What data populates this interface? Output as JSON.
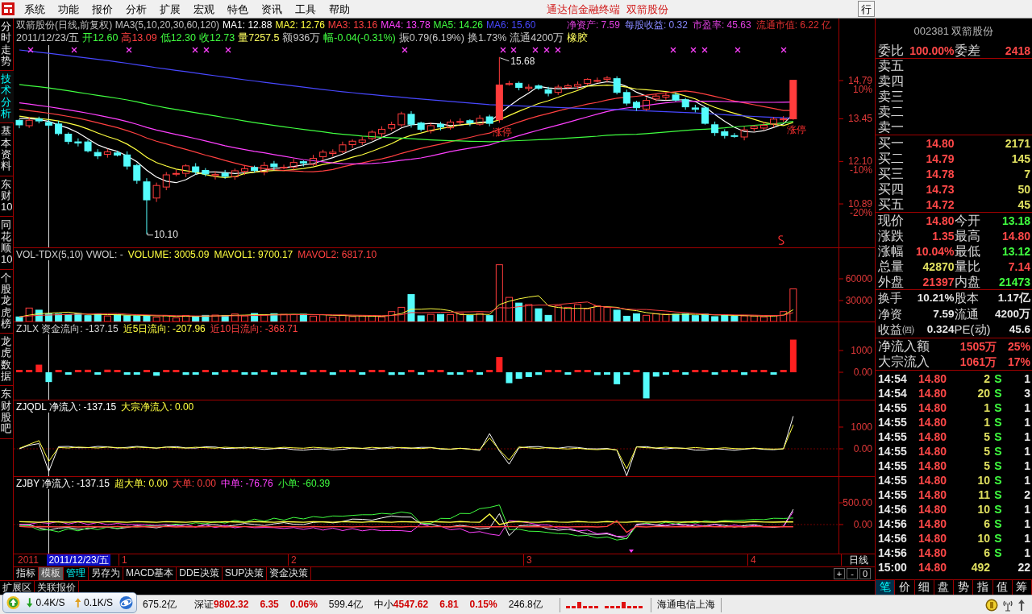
{
  "menu_bar": {
    "items": [
      "系统",
      "功能",
      "报价",
      "分析",
      "扩展",
      "宏观",
      "特色",
      "资讯",
      "工具",
      "帮助"
    ],
    "title": "通达信金融终端",
    "stock": "双箭股份",
    "button": "行"
  },
  "side_tabs": [
    {
      "label": "分时走势",
      "selected": false
    },
    {
      "label": "技术分析",
      "selected": true
    },
    {
      "label": "基本资料",
      "selected": false
    },
    {
      "label": "东财10",
      "selected": false
    },
    {
      "label": "同花顺10",
      "selected": false
    },
    {
      "label": "个股龙虎榜",
      "selected": false
    },
    {
      "label": "龙虎数据",
      "selected": false
    },
    {
      "label": "东财股吧",
      "selected": false
    }
  ],
  "price_chart": {
    "legend": [
      {
        "text": "双箭股份(日线,前复权) MA3(5,10,20,30,60,120)",
        "color": "#c0c0c0"
      },
      {
        "text": "MA1: 12.88",
        "color": "#ffffff"
      },
      {
        "text": "MA2: 12.76",
        "color": "#ffff40"
      },
      {
        "text": "MA3: 13.16",
        "color": "#ff4040"
      },
      {
        "text": "MA4: 13.78",
        "color": "#ff40ff"
      },
      {
        "text": "MA5: 14.26",
        "color": "#40ff40"
      },
      {
        "text": "MA6: 15.60",
        "color": "#4848ff"
      }
    ],
    "fundamentals": [
      {
        "text": "净资产: 7.59",
        "color": "#e040e0"
      },
      {
        "text": "每股收益: 0.32",
        "color": "#8888ff"
      },
      {
        "text": "市盈率: 45.63",
        "color": "#e040e0"
      },
      {
        "text": "流通市值: 6.22 亿",
        "color": "#e03030"
      }
    ],
    "day_info": [
      {
        "text": "2011/12/23/五",
        "color": "#c8c8c8"
      },
      {
        "text": "开12.60",
        "color": "#40ff40"
      },
      {
        "text": "高13.09",
        "color": "#ff4040"
      },
      {
        "text": "低12.30",
        "color": "#40ff40"
      },
      {
        "text": "收12.73",
        "color": "#40ff40"
      },
      {
        "text": "量7257.5",
        "color": "#ffff60"
      },
      {
        "text": "额936万",
        "color": "#c8c8c8"
      },
      {
        "text": "幅-0.04(-0.31%)",
        "color": "#40ff40"
      },
      {
        "text": "振0.79(6.19%)",
        "color": "#c8c8c8"
      },
      {
        "text": "换1.73%",
        "color": "#c8c8c8"
      },
      {
        "text": "流通4200万",
        "color": "#c8c8c8"
      },
      {
        "text": "橡胶",
        "color": "#ffff60"
      }
    ],
    "axis_labels": [
      {
        "price": "14.79",
        "change": "10%"
      },
      {
        "price": "13.45"
      },
      {
        "price": "12.10",
        "change": "-10%"
      },
      {
        "price": "10.89",
        "change": "-20%"
      }
    ],
    "annotations": [
      {
        "kind": "high",
        "text": "15.68"
      },
      {
        "kind": "low",
        "text": "10.10"
      },
      {
        "kind": "limit_up",
        "text": "涨停"
      },
      {
        "kind": "limit_up",
        "text": "涨停"
      }
    ]
  },
  "indicators": [
    {
      "kind": "volume",
      "legend": [
        {
          "text": "VOL-TDX(5,10) VWOL: -",
          "color": "#d0d0d0"
        },
        {
          "text": "VOLUME: 3005.09",
          "color": "#ffff40"
        },
        {
          "text": "MAVOL1: 9700.17",
          "color": "#ffff40"
        },
        {
          "text": "MAVOL2: 6817.10",
          "color": "#ff4040"
        }
      ],
      "axis_labels": [
        "60000",
        "30000"
      ]
    },
    {
      "kind": "flow_bars",
      "legend": [
        {
          "text": "ZJLX 资金流向: -137.15",
          "color": "#d0d0d0"
        },
        {
          "text": "近5日流向: -207.96",
          "color": "#ffff40"
        },
        {
          "text": "近10日流向: -368.71",
          "color": "#ff4040"
        }
      ],
      "axis_labels": [
        "1000",
        "0.00"
      ]
    },
    {
      "kind": "lines",
      "legend": [
        {
          "text": "ZJQDL 净流入: -137.15",
          "color": "#ffffff"
        },
        {
          "text": "大宗净流入: 0.00",
          "color": "#ffff40"
        }
      ],
      "axis_labels": [
        "1000",
        "0.00"
      ]
    },
    {
      "kind": "lines",
      "legend": [
        {
          "text": "ZJBY 净流入: -137.15",
          "color": "#ffffff"
        },
        {
          "text": "超大单: 0.00",
          "color": "#ffff40"
        },
        {
          "text": "大单: 0.00",
          "color": "#ff4040"
        },
        {
          "text": "中单: -76.76",
          "color": "#ff40ff"
        },
        {
          "text": "小单: -60.39",
          "color": "#40ff40"
        }
      ],
      "axis_labels": [
        "500.00",
        "0.00"
      ]
    }
  ],
  "time_axis": {
    "year": "2011",
    "cursor_date": "2011/12/23/五",
    "months": [
      "1",
      "2",
      "3",
      "4"
    ],
    "period": "日线"
  },
  "formula_tabs": [
    {
      "label": "指标",
      "selected": false,
      "highlighted": false
    },
    {
      "label": "模板",
      "selected": true,
      "highlighted": false
    },
    {
      "label": "管理",
      "selected": false,
      "highlighted": true
    },
    {
      "label": "另存为",
      "selected": false,
      "highlighted": false
    },
    {
      "label": "MACD基本",
      "selected": false,
      "highlighted": false
    },
    {
      "label": "DDE决策",
      "selected": false,
      "highlighted": false
    },
    {
      "label": "SUP决策",
      "selected": false,
      "highlighted": false
    },
    {
      "label": "资金决策",
      "selected": false,
      "highlighted": false
    }
  ],
  "zoom_buttons": [
    "+",
    "-",
    "0"
  ],
  "area_tabs": [
    {
      "label": "扩展区",
      "selected": false
    },
    {
      "label": "关联报价",
      "selected": false
    }
  ],
  "quote_panel": {
    "title": "002381 双箭股份",
    "order_ratio": [
      {
        "label": "委比",
        "value": "100.00%"
      },
      {
        "label": "委差",
        "value": "2418"
      }
    ],
    "asks": [
      {
        "label": "卖五"
      },
      {
        "label": "卖四"
      },
      {
        "label": "卖三"
      },
      {
        "label": "卖二"
      },
      {
        "label": "卖一"
      }
    ],
    "bids": [
      {
        "label": "买一",
        "price": "14.80",
        "volume": "2171"
      },
      {
        "label": "买二",
        "price": "14.79",
        "volume": "145"
      },
      {
        "label": "买三",
        "price": "14.78",
        "volume": "7"
      },
      {
        "label": "买四",
        "price": "14.73",
        "volume": "50"
      },
      {
        "label": "买五",
        "price": "14.72",
        "volume": "45"
      }
    ],
    "stats": [
      {
        "label": "现价",
        "value": "14.80",
        "color": "#ff4848"
      },
      {
        "label": "今开",
        "value": "13.18",
        "color": "#40ff40"
      },
      {
        "label": "涨跌",
        "value": "1.35",
        "color": "#ff4848"
      },
      {
        "label": "最高",
        "value": "14.80",
        "color": "#ff4848"
      },
      {
        "label": "涨幅",
        "value": "10.04%",
        "color": "#ff4848"
      },
      {
        "label": "最低",
        "value": "13.12",
        "color": "#40ff40"
      },
      {
        "label": "总量",
        "value": "42870",
        "color": "#e0e060"
      },
      {
        "label": "量比",
        "value": "7.14",
        "color": "#ff4848"
      },
      {
        "label": "外盘",
        "value": "21397",
        "color": "#ff4848"
      },
      {
        "label": "内盘",
        "value": "21473",
        "color": "#40ff40"
      }
    ],
    "finance": [
      {
        "label": "换手",
        "value": "10.21%"
      },
      {
        "label": "股本",
        "value": "1.17亿"
      },
      {
        "label": "净资",
        "value": "7.59"
      },
      {
        "label": "流通",
        "value": "4200万"
      },
      {
        "label": "收益㈣",
        "value": "0.324"
      },
      {
        "label": "PE(动)",
        "value": "45.6"
      }
    ],
    "flows": [
      {
        "label": "净流入额",
        "amount": "1505万",
        "share": "25%"
      },
      {
        "label": "大宗流入",
        "amount": "1061万",
        "share": "17%"
      }
    ],
    "ticks": [
      {
        "time": "14:54",
        "price": "14.80",
        "volume": "2",
        "side": "S",
        "count": "1"
      },
      {
        "time": "14:54",
        "price": "14.80",
        "volume": "20",
        "side": "S",
        "count": "3"
      },
      {
        "time": "14:55",
        "price": "14.80",
        "volume": "1",
        "side": "S",
        "count": "1"
      },
      {
        "time": "14:55",
        "price": "14.80",
        "volume": "1",
        "side": "S",
        "count": "1"
      },
      {
        "time": "14:55",
        "price": "14.80",
        "volume": "5",
        "side": "S",
        "count": "1"
      },
      {
        "time": "14:55",
        "price": "14.80",
        "volume": "5",
        "side": "S",
        "count": "1"
      },
      {
        "time": "14:55",
        "price": "14.80",
        "volume": "5",
        "side": "S",
        "count": "1"
      },
      {
        "time": "14:55",
        "price": "14.80",
        "volume": "10",
        "side": "S",
        "count": "1"
      },
      {
        "time": "14:55",
        "price": "14.80",
        "volume": "11",
        "side": "S",
        "count": "2"
      },
      {
        "time": "14:56",
        "price": "14.80",
        "volume": "10",
        "side": "S",
        "count": "1"
      },
      {
        "time": "14:56",
        "price": "14.80",
        "volume": "6",
        "side": "S",
        "count": "1"
      },
      {
        "time": "14:56",
        "price": "14.80",
        "volume": "10",
        "side": "S",
        "count": "1"
      },
      {
        "time": "14:56",
        "price": "14.80",
        "volume": "6",
        "side": "S",
        "count": "1"
      },
      {
        "time": "15:00",
        "price": "14.80",
        "volume": "492",
        "count": "22"
      }
    ],
    "tabs": [
      {
        "label": "笔",
        "selected": true
      },
      {
        "label": "价",
        "selected": false
      },
      {
        "label": "细",
        "selected": false
      },
      {
        "label": "盘",
        "selected": false
      },
      {
        "label": "势",
        "selected": false
      },
      {
        "label": "指",
        "selected": false
      },
      {
        "label": "值",
        "selected": false
      },
      {
        "label": "筹",
        "selected": false
      }
    ]
  },
  "status_bar": {
    "speed": {
      "down": "0.4K/S",
      "up": "0.1K/S"
    },
    "indices": [
      {
        "amount": "675.2亿"
      },
      {
        "name": "深证",
        "value": "9802.32",
        "change": "6.35",
        "percent": "0.06%",
        "amount": "599.4亿",
        "color": "#d00000"
      },
      {
        "name": "中小",
        "value": "4547.62",
        "change": "6.81",
        "percent": "0.15%",
        "amount": "246.8亿",
        "color": "#d00000"
      }
    ],
    "broker": "海通电信上海"
  }
}
